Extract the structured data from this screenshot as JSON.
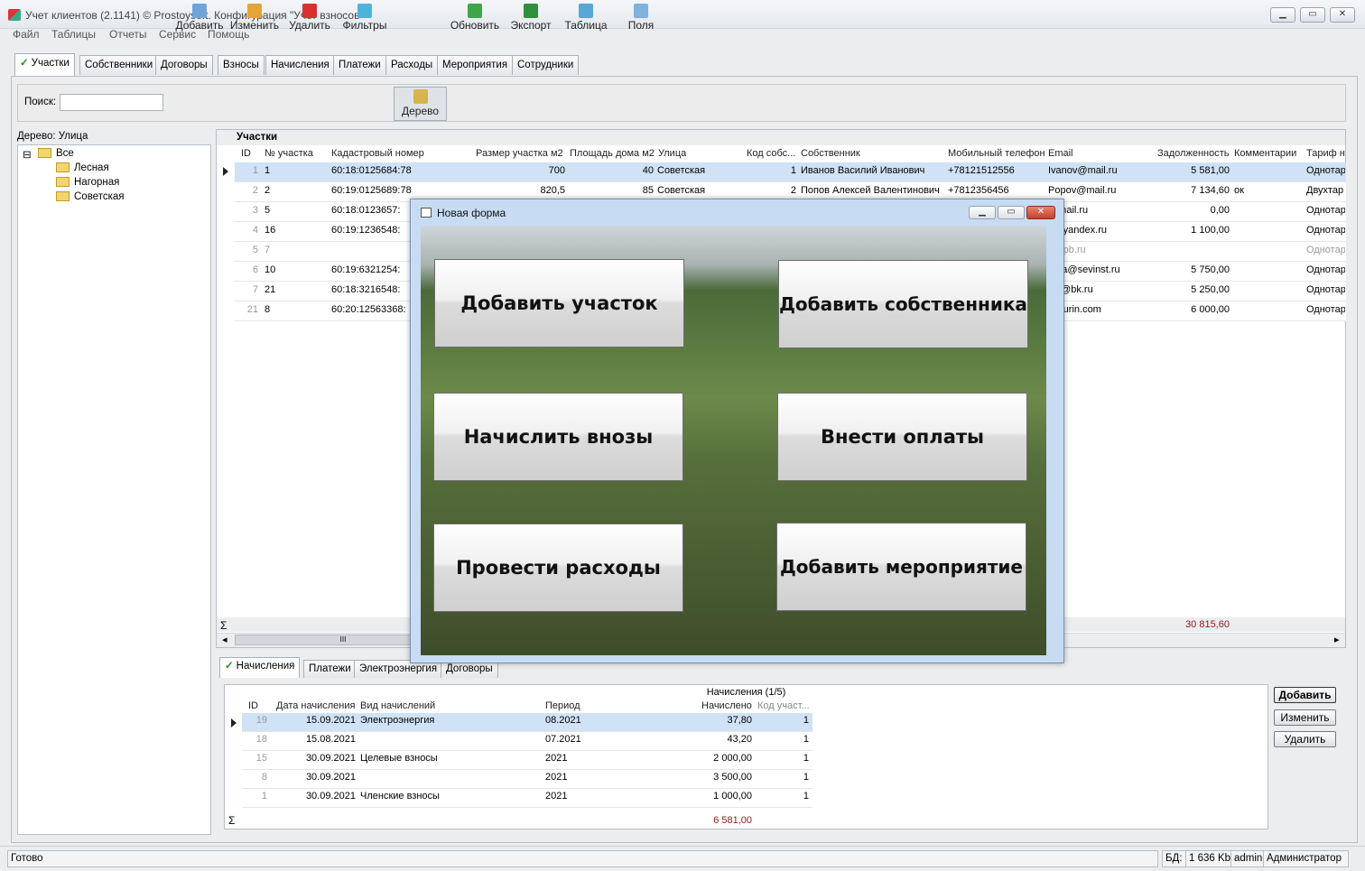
{
  "window": {
    "title": "Учет клиентов (2.1141) © Prostoysoft. Конфигурация \"Учет взносов\"",
    "buttons": [
      "▁",
      "▭",
      "✕"
    ]
  },
  "menu": [
    "Файл",
    "Таблицы",
    "Отчеты",
    "Сервис",
    "Помощь"
  ],
  "tabs": [
    "Участки",
    "Собственники",
    "Договоры",
    "Взносы",
    "Начисления",
    "Платежи",
    "Расходы",
    "Мероприятия",
    "Сотрудники"
  ],
  "check_mark": "✓",
  "toolbar": {
    "search_label": "Поиск:",
    "search_value": "",
    "buttons": [
      "Добавить",
      "Изменить",
      "Удалить",
      "Фильтры",
      "Дерево",
      "Обновить",
      "Экспорт",
      "Таблица",
      "Поля"
    ],
    "icons": [
      "add-icon",
      "edit-icon",
      "delete-icon",
      "filter-icon",
      "tree-icon",
      "refresh-icon",
      "export-icon",
      "table-icon",
      "fields-icon"
    ]
  },
  "tree": {
    "title": "Дерево: Улица",
    "expander": "⊟",
    "root": "Все",
    "children": [
      "Лесная",
      "Нагорная",
      "Советская"
    ]
  },
  "grid": {
    "caption": "Участки",
    "columns": [
      "ID",
      "№ участка",
      "Кадастровый номер",
      "Размер участка м2",
      "Площадь дома м2",
      "Улица",
      "Код собс...",
      "Собственник",
      "Мобильный телефон",
      "Email",
      "Задолженность",
      "Комментарии",
      "Тариф на"
    ],
    "rows": [
      {
        "id": "1",
        "num": "1",
        "cad": "60:18:0125684:78",
        "size": "700",
        "house": "40",
        "street": "Советская",
        "code": "1",
        "owner": "Иванов Василий Иванович",
        "phone": "+78121512556",
        "email": "Ivanov@mail.ru",
        "debt": "5 581,00",
        "comment": "",
        "tariff": "Однотар"
      },
      {
        "id": "2",
        "num": "2",
        "cad": "60:19:0125689:78",
        "size": "820,5",
        "house": "85",
        "street": "Советская",
        "code": "2",
        "owner": "Попов Алексей Валентинович",
        "phone": "+7812356456",
        "email": "Popov@mail.ru",
        "debt": "7 134,60",
        "comment": "ок",
        "tariff": "Двухтар"
      },
      {
        "id": "3",
        "num": "5",
        "cad": "60:18:0123657:",
        "size": "",
        "house": "",
        "street": "",
        "code": "",
        "owner": "",
        "phone": "",
        "email": "@mail.ru",
        "debt": "0,00",
        "comment": "",
        "tariff": "Однотар"
      },
      {
        "id": "4",
        "num": "16",
        "cad": "60:19:1236548:",
        "size": "",
        "house": "",
        "street": "",
        "code": "",
        "owner": "",
        "phone": "",
        "email": "v@yandex.ru",
        "debt": "1 100,00",
        "comment": "",
        "tariff": "Однотар"
      },
      {
        "id": "5",
        "num": "7",
        "cad": "",
        "size": "",
        "house": "",
        "street": "",
        "code": "",
        "owner": "",
        "phone": "",
        "email": "@spb.ru",
        "debt": "",
        "comment": "",
        "tariff": "Однотар"
      },
      {
        "id": "6",
        "num": "10",
        "cad": "60:19:6321254:",
        "size": "",
        "house": "",
        "street": "",
        "code": "",
        "owner": "",
        "phone": "",
        "email": "rova@sevinst.ru",
        "debt": "5 750,00",
        "comment": "",
        "tariff": "Однотар"
      },
      {
        "id": "7",
        "num": "21",
        "cad": "60:18:3216548:",
        "size": "",
        "house": "",
        "street": "",
        "code": "",
        "owner": "",
        "phone": "",
        "email": "lov@bk.ru",
        "debt": "5 250,00",
        "comment": "",
        "tariff": "Однотар"
      },
      {
        "id": "21",
        "num": "8",
        "cad": "60:20:12563368:",
        "size": "",
        "house": "",
        "street": "",
        "code": "",
        "owner": "",
        "phone": "",
        "email": "@yurin.com",
        "debt": "6 000,00",
        "comment": "",
        "tariff": "Однотар"
      }
    ],
    "sum_symbol": "Σ",
    "debt_total": "30 815,60",
    "scroll_left": "◂",
    "scroll_right": "▸",
    "scroll_grip": "III"
  },
  "modal": {
    "title": "Новая форма",
    "buttons": [
      "Добавить участок",
      "Добавить собственника",
      "Начислить внозы",
      "Внести оплаты",
      "Провести расходы",
      "Добавить мероприятие"
    ],
    "window_buttons": [
      "▁",
      "▭",
      "✕"
    ]
  },
  "bottom_tabs": [
    "Начисления",
    "Платежи",
    "Электроэнергия",
    "Договоры"
  ],
  "subgrid": {
    "caption": "Начисления (1/5)",
    "columns": [
      "ID",
      "Дата начисления",
      "Вид начислений",
      "Период",
      "Начислено",
      "Код участ..."
    ],
    "rows": [
      {
        "id": "19",
        "date": "15.09.2021",
        "type": "Электроэнергия",
        "period": "08.2021",
        "amount": "37,80",
        "code": "1"
      },
      {
        "id": "18",
        "date": "15.08.2021",
        "type": "",
        "period": "07.2021",
        "amount": "43,20",
        "code": "1"
      },
      {
        "id": "15",
        "date": "30.09.2021",
        "type": "Целевые взносы",
        "period": "2021",
        "amount": "2 000,00",
        "code": "1"
      },
      {
        "id": "8",
        "date": "30.09.2021",
        "type": "",
        "period": "2021",
        "amount": "3 500,00",
        "code": "1"
      },
      {
        "id": "1",
        "date": "30.09.2021",
        "type": "Членские взносы",
        "period": "2021",
        "amount": "1 000,00",
        "code": "1"
      }
    ],
    "sum_symbol": "Σ",
    "total": "6 581,00",
    "buttons": [
      "Добавить",
      "Изменить",
      "Удалить"
    ]
  },
  "status": {
    "text": "Готово",
    "db_label": "БД:",
    "db_size": "1 636 Kb",
    "user": "admin",
    "role": "Администратор"
  }
}
